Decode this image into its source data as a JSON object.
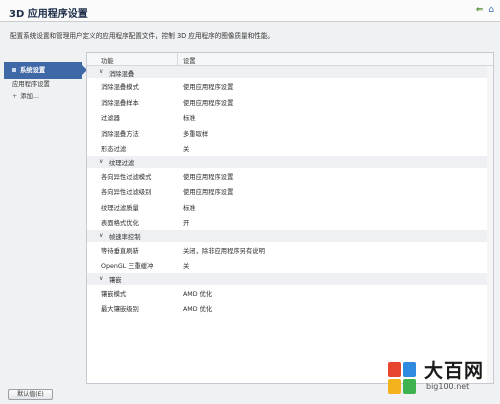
{
  "window": {
    "title": "3D 应用程序设置",
    "back_icon": "back-arrow-icon",
    "home_icon": "home-icon"
  },
  "description": "配置系统设置和管理用户定义的应用程序配置文件，控制 3D 应用程序的图像质量和性能。",
  "sidebar": {
    "items": [
      {
        "label": "系统设置",
        "active": true
      },
      {
        "label": "应用程序设置",
        "active": false
      },
      {
        "label": "添加...",
        "active": false
      }
    ]
  },
  "table": {
    "headers": {
      "function": "功能",
      "setting": "设置"
    },
    "groups": [
      {
        "title": "消除混叠",
        "rows": [
          {
            "k": "消除混叠模式",
            "v": "使用应用程序设置"
          },
          {
            "k": "消除混叠样本",
            "v": "使用应用程序设置"
          },
          {
            "k": "过滤器",
            "v": "标准"
          },
          {
            "k": "消除混叠方法",
            "v": "多重取样"
          },
          {
            "k": "形态过滤",
            "v": "关"
          }
        ]
      },
      {
        "title": "纹理过滤",
        "rows": [
          {
            "k": "各向异性过滤模式",
            "v": "使用应用程序设置"
          },
          {
            "k": "各向异性过滤级别",
            "v": "使用应用程序设置"
          },
          {
            "k": "纹理过滤质量",
            "v": "标准"
          },
          {
            "k": "表面格式优化",
            "v": "开"
          }
        ]
      },
      {
        "title": "帧速率控制",
        "rows": [
          {
            "k": "等待垂直刷新",
            "v": "关闭，除非应用程序另有说明"
          },
          {
            "k": "OpenGL 三重缓冲",
            "v": "关"
          }
        ]
      },
      {
        "title": "镶嵌",
        "rows": [
          {
            "k": "镶嵌模式",
            "v": "AMD 优化"
          },
          {
            "k": "最大镶嵌级别",
            "v": "AMD 优化"
          }
        ]
      }
    ]
  },
  "footer": {
    "default_button": "默认值(E)"
  },
  "watermark": {
    "name": "大百网",
    "url": "big100.net"
  },
  "colors": {
    "accent": "#3f68a6",
    "group_bg": "#eef0f3"
  }
}
